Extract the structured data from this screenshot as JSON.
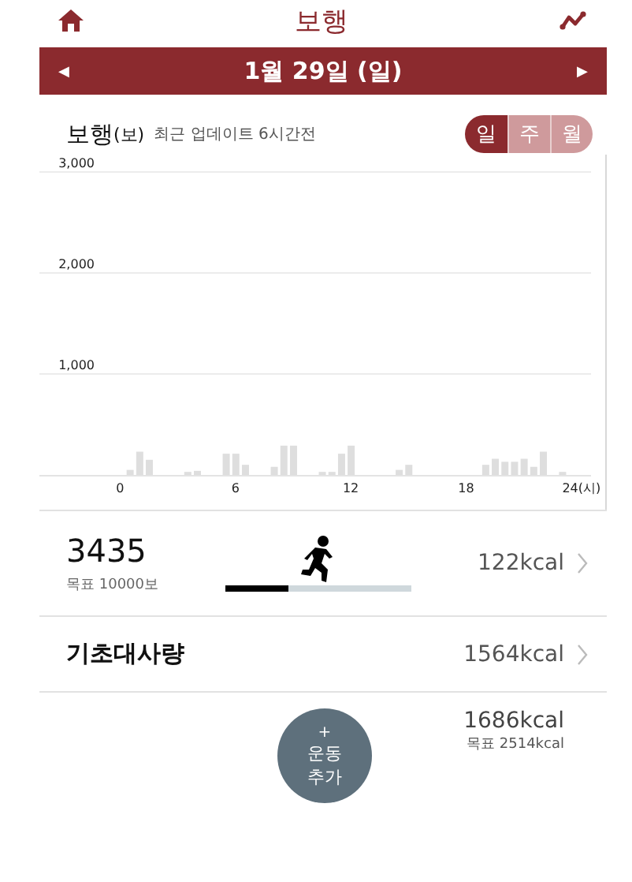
{
  "header": {
    "title": "보행"
  },
  "date_bar": {
    "prev": "◀",
    "label": "1월 29일 (일)",
    "next": "▶"
  },
  "section": {
    "title": "보행",
    "unit": "(보)",
    "updated": "최근 업데이트 6시간전",
    "periods": [
      {
        "label": "일",
        "selected": true
      },
      {
        "label": "주",
        "selected": false
      },
      {
        "label": "월",
        "selected": false
      }
    ]
  },
  "chart_data": {
    "type": "bar",
    "x": [
      0.5,
      1,
      1.5,
      3.5,
      4,
      5.5,
      6,
      6.5,
      8,
      8.5,
      9,
      10.5,
      11,
      11.5,
      12,
      14.5,
      15,
      19,
      19.5,
      20,
      20.5,
      21,
      21.5,
      22,
      23
    ],
    "values": [
      50,
      230,
      150,
      30,
      40,
      210,
      210,
      100,
      80,
      290,
      290,
      30,
      30,
      210,
      290,
      50,
      100,
      100,
      160,
      130,
      130,
      160,
      80,
      230,
      30
    ],
    "xlim": [
      -4.2,
      24.5
    ],
    "ylim": [
      0,
      3000
    ],
    "xticks": [
      0,
      6,
      12,
      18,
      {
        "value": 24,
        "label": "24(시)"
      }
    ],
    "yticks": [
      {
        "value": 1000,
        "label": "1,000"
      },
      {
        "value": 2000,
        "label": "2,000"
      },
      {
        "value": 3000,
        "label": "3,000"
      }
    ]
  },
  "steps": {
    "count": "3435",
    "goal": "목표 10000보",
    "level": 0.34,
    "kcal": "122kcal"
  },
  "bmr": {
    "label": "기초대사량",
    "kcal": "1564kcal"
  },
  "add_button": {
    "plus": "+",
    "label": "운동\n추가"
  },
  "total": {
    "kcal": "1686kcal",
    "goal": "목표 2514kcal"
  }
}
